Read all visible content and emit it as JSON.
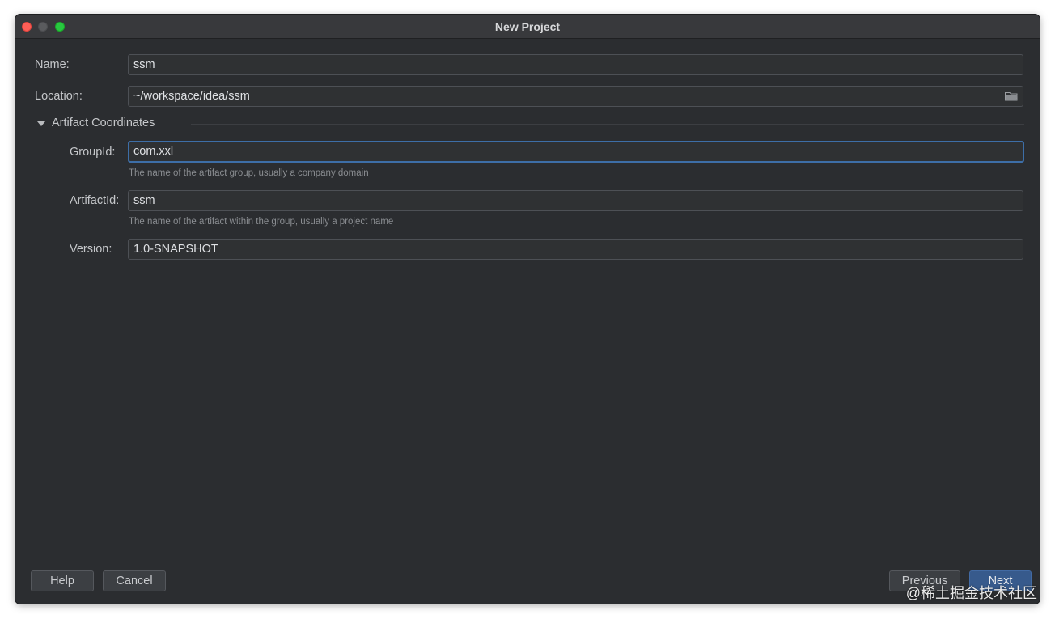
{
  "window": {
    "title": "New Project"
  },
  "form": {
    "name_label": "Name:",
    "name_value": "ssm",
    "location_label": "Location:",
    "location_value": "~/workspace/idea/ssm",
    "section_label": "Artifact Coordinates",
    "groupid_label": "GroupId:",
    "groupid_value": "com.xxl",
    "groupid_hint": "The name of the artifact group, usually a company domain",
    "artifactid_label": "ArtifactId:",
    "artifactid_value": "ssm",
    "artifactid_hint": "The name of the artifact within the group, usually a project name",
    "version_label": "Version:",
    "version_value": "1.0-SNAPSHOT"
  },
  "buttons": {
    "help": "Help",
    "cancel": "Cancel",
    "previous": "Previous",
    "next": "Next"
  },
  "watermark": "@稀土掘金技术社区",
  "icons": [
    "folder-icon",
    "collapse-triangle-icon"
  ]
}
